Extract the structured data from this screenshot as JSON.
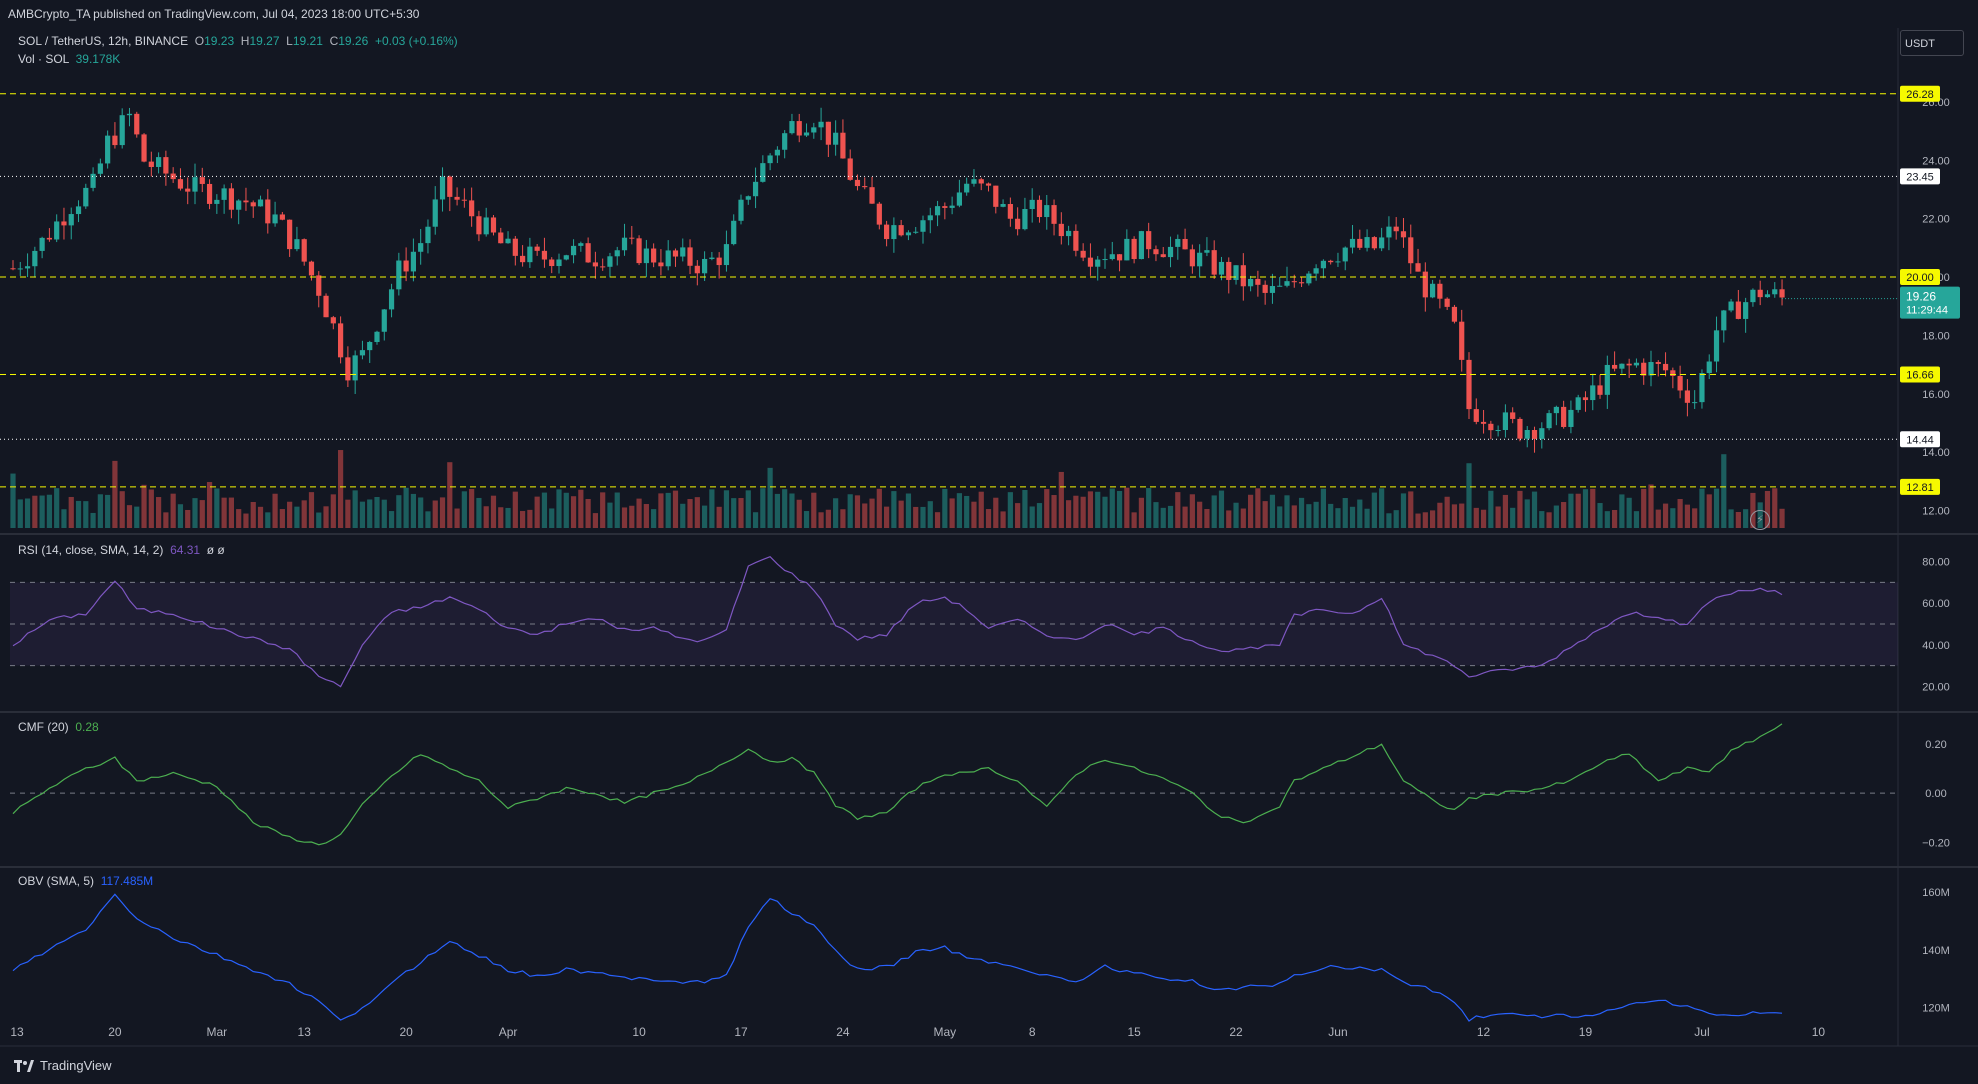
{
  "header": {
    "published_by": "AMBCrypto_TA published on TradingView.com, Jul 04, 2023 18:00 UTC+5:30"
  },
  "currency_box": "USDT",
  "legend": {
    "symbol": "SOL / TetherUS, 12h, BINANCE",
    "o_label": "O",
    "o_value": "19.23",
    "h_label": "H",
    "h_value": "19.27",
    "l_label": "L",
    "l_value": "19.21",
    "c_label": "C",
    "c_value": "19.26",
    "change": "+0.03 (+0.16%)",
    "volume_label": "Vol · SOL",
    "volume_value": "39.178K"
  },
  "indicators": {
    "rsi_label": "RSI (14, close, SMA, 14, 2)",
    "rsi_value": "64.31",
    "rsi_extra": "ø ø",
    "cmf_label": "CMF (20)",
    "cmf_value": "0.28",
    "obv_label": "OBV (SMA, 5)",
    "obv_value": "117.485M"
  },
  "footer": {
    "brand": "TradingView"
  },
  "colors": {
    "bull": "#26a69a",
    "bear": "#ef5350",
    "level": "#f6f900",
    "rsi": "#7e57c2",
    "cmf": "#4caf50",
    "obv": "#2962ff"
  },
  "chart_data": [
    {
      "type": "candlestick",
      "title": "SOL / TetherUS, 12h, BINANCE",
      "ylim": [
        11.4,
        27.3
      ],
      "y_ticks": [
        12,
        14,
        16,
        18,
        20,
        22,
        24,
        26
      ],
      "x_ticks": [
        "13",
        "20",
        "Mar",
        "13",
        "20",
        "Apr",
        "10",
        "17",
        "24",
        "May",
        "8",
        "15",
        "22",
        "Jun",
        "12",
        "19",
        "Jul",
        "10"
      ],
      "last_price": "19.26",
      "countdown": "11:29:44",
      "horizontal_levels": [
        {
          "value": 26.28,
          "label": "26.28",
          "style": "dashed",
          "color": "#f6f900"
        },
        {
          "value": 23.45,
          "label": "23.45",
          "style": "dotted",
          "color": "#ffffff"
        },
        {
          "value": 20.0,
          "label": "20.00",
          "style": "dashed",
          "color": "#f6f900"
        },
        {
          "value": 16.66,
          "label": "16.66",
          "style": "dashed",
          "color": "#f6f900"
        },
        {
          "value": 14.44,
          "label": "14.44",
          "style": "dotted",
          "color": "#ffffff"
        },
        {
          "value": 12.81,
          "label": "12.81",
          "style": "dashed",
          "color": "#f6f900"
        }
      ],
      "close_path": [
        [
          0,
          20.3
        ],
        [
          4,
          21.2
        ],
        [
          8,
          22.5
        ],
        [
          11,
          23.1
        ],
        [
          13,
          24.6
        ],
        [
          16,
          25.5
        ],
        [
          18,
          24.0
        ],
        [
          22,
          23.4
        ],
        [
          25,
          23.0
        ],
        [
          28,
          22.9
        ],
        [
          32,
          22.6
        ],
        [
          36,
          22.0
        ],
        [
          39,
          21.0
        ],
        [
          42,
          19.6
        ],
        [
          44,
          18.3
        ],
        [
          46,
          16.9
        ],
        [
          48,
          17.3
        ],
        [
          50,
          18.5
        ],
        [
          53,
          20.2
        ],
        [
          56,
          21.2
        ],
        [
          59,
          23.0
        ],
        [
          62,
          22.4
        ],
        [
          65,
          21.6
        ],
        [
          68,
          20.9
        ],
        [
          72,
          20.6
        ],
        [
          76,
          20.9
        ],
        [
          80,
          20.7
        ],
        [
          84,
          21.0
        ],
        [
          88,
          20.7
        ],
        [
          92,
          20.6
        ],
        [
          95,
          20.4
        ],
        [
          98,
          20.9
        ],
        [
          101,
          23.0
        ],
        [
          104,
          24.2
        ],
        [
          107,
          25.2
        ],
        [
          110,
          25.5
        ],
        [
          113,
          24.5
        ],
        [
          116,
          23.0
        ],
        [
          120,
          21.7
        ],
        [
          124,
          21.9
        ],
        [
          128,
          22.4
        ],
        [
          131,
          23.2
        ],
        [
          134,
          22.9
        ],
        [
          137,
          22.0
        ],
        [
          141,
          22.3
        ],
        [
          145,
          21.5
        ],
        [
          148,
          20.8
        ],
        [
          152,
          20.9
        ],
        [
          156,
          21.2
        ],
        [
          160,
          20.9
        ],
        [
          164,
          20.5
        ],
        [
          168,
          20.0
        ],
        [
          172,
          19.4
        ],
        [
          175,
          19.6
        ],
        [
          179,
          20.6
        ],
        [
          183,
          21.0
        ],
        [
          187,
          21.0
        ],
        [
          190,
          21.7
        ],
        [
          193,
          20.0
        ],
        [
          196,
          19.0
        ],
        [
          198,
          18.2
        ],
        [
          200,
          15.5
        ],
        [
          203,
          15.2
        ],
        [
          207,
          14.8
        ],
        [
          211,
          15.0
        ],
        [
          215,
          15.5
        ],
        [
          219,
          16.6
        ],
        [
          223,
          17.0
        ],
        [
          227,
          16.8
        ],
        [
          231,
          15.8
        ],
        [
          234,
          18.2
        ],
        [
          237,
          19.0
        ],
        [
          240,
          19.5
        ],
        [
          243,
          19.26
        ]
      ]
    },
    {
      "type": "line",
      "name": "RSI (14, close, SMA, 14, 2)",
      "ylim": [
        12,
        88
      ],
      "y_ticks": [
        20,
        40,
        60,
        80
      ],
      "bands": [
        30,
        50,
        70
      ],
      "points": [
        [
          0,
          40
        ],
        [
          5,
          52
        ],
        [
          10,
          55
        ],
        [
          14,
          71
        ],
        [
          17,
          57
        ],
        [
          22,
          55
        ],
        [
          28,
          48
        ],
        [
          33,
          43
        ],
        [
          38,
          38
        ],
        [
          42,
          25
        ],
        [
          45,
          20
        ],
        [
          48,
          40
        ],
        [
          52,
          56
        ],
        [
          56,
          58
        ],
        [
          60,
          63
        ],
        [
          64,
          57
        ],
        [
          68,
          48
        ],
        [
          72,
          45
        ],
        [
          76,
          50
        ],
        [
          80,
          53
        ],
        [
          84,
          47
        ],
        [
          88,
          48
        ],
        [
          92,
          43
        ],
        [
          95,
          42
        ],
        [
          98,
          47
        ],
        [
          101,
          78
        ],
        [
          104,
          82
        ],
        [
          107,
          74
        ],
        [
          110,
          67
        ],
        [
          113,
          50
        ],
        [
          116,
          43
        ],
        [
          120,
          45
        ],
        [
          124,
          60
        ],
        [
          128,
          63
        ],
        [
          131,
          57
        ],
        [
          134,
          48
        ],
        [
          138,
          52
        ],
        [
          142,
          45
        ],
        [
          146,
          42
        ],
        [
          150,
          50
        ],
        [
          154,
          45
        ],
        [
          158,
          48
        ],
        [
          162,
          42
        ],
        [
          166,
          37
        ],
        [
          170,
          38
        ],
        [
          174,
          40
        ],
        [
          176,
          54
        ],
        [
          180,
          57
        ],
        [
          184,
          55
        ],
        [
          188,
          63
        ],
        [
          191,
          40
        ],
        [
          195,
          35
        ],
        [
          198,
          30
        ],
        [
          200,
          25
        ],
        [
          205,
          28
        ],
        [
          210,
          30
        ],
        [
          214,
          39
        ],
        [
          218,
          48
        ],
        [
          222,
          55
        ],
        [
          226,
          54
        ],
        [
          230,
          49
        ],
        [
          233,
          61
        ],
        [
          236,
          65
        ],
        [
          240,
          67
        ],
        [
          243,
          64.31
        ]
      ]
    },
    {
      "type": "line",
      "name": "CMF (20)",
      "ylim": [
        -0.28,
        0.31
      ],
      "y_ticks": [
        -0.2,
        0.0,
        0.2
      ],
      "bands": [
        0
      ],
      "points": [
        [
          0,
          -0.08
        ],
        [
          5,
          0.02
        ],
        [
          10,
          0.1
        ],
        [
          14,
          0.14
        ],
        [
          17,
          0.05
        ],
        [
          22,
          0.08
        ],
        [
          28,
          0.03
        ],
        [
          33,
          -0.12
        ],
        [
          38,
          -0.18
        ],
        [
          42,
          -0.21
        ],
        [
          45,
          -0.17
        ],
        [
          48,
          -0.05
        ],
        [
          52,
          0.07
        ],
        [
          56,
          0.16
        ],
        [
          60,
          0.1
        ],
        [
          64,
          0.05
        ],
        [
          68,
          -0.06
        ],
        [
          72,
          -0.02
        ],
        [
          76,
          0.02
        ],
        [
          80,
          0.0
        ],
        [
          84,
          -0.04
        ],
        [
          88,
          0.0
        ],
        [
          92,
          0.03
        ],
        [
          95,
          0.08
        ],
        [
          98,
          0.13
        ],
        [
          101,
          0.18
        ],
        [
          104,
          0.13
        ],
        [
          107,
          0.14
        ],
        [
          110,
          0.08
        ],
        [
          113,
          -0.05
        ],
        [
          116,
          -0.1
        ],
        [
          120,
          -0.08
        ],
        [
          124,
          0.02
        ],
        [
          128,
          0.08
        ],
        [
          131,
          0.08
        ],
        [
          134,
          0.1
        ],
        [
          138,
          0.05
        ],
        [
          142,
          -0.06
        ],
        [
          146,
          0.08
        ],
        [
          150,
          0.14
        ],
        [
          154,
          0.1
        ],
        [
          158,
          0.06
        ],
        [
          162,
          0.0
        ],
        [
          166,
          -0.1
        ],
        [
          170,
          -0.12
        ],
        [
          174,
          -0.05
        ],
        [
          176,
          0.05
        ],
        [
          180,
          0.1
        ],
        [
          184,
          0.15
        ],
        [
          188,
          0.2
        ],
        [
          191,
          0.05
        ],
        [
          195,
          -0.03
        ],
        [
          198,
          -0.07
        ],
        [
          200,
          -0.02
        ],
        [
          205,
          0.0
        ],
        [
          210,
          0.02
        ],
        [
          214,
          0.05
        ],
        [
          218,
          0.12
        ],
        [
          222,
          0.16
        ],
        [
          226,
          0.05
        ],
        [
          230,
          0.1
        ],
        [
          233,
          0.09
        ],
        [
          236,
          0.17
        ],
        [
          240,
          0.23
        ],
        [
          243,
          0.28
        ]
      ]
    },
    {
      "type": "line",
      "name": "OBV (SMA, 5)",
      "ylim": [
        108,
        167
      ],
      "y_ticks": [
        "120M",
        "140M",
        "160M"
      ],
      "y_tick_values": [
        120,
        140,
        160
      ],
      "points": [
        [
          0,
          133
        ],
        [
          5,
          140
        ],
        [
          10,
          147
        ],
        [
          14,
          159
        ],
        [
          17,
          151
        ],
        [
          22,
          144
        ],
        [
          28,
          138
        ],
        [
          33,
          133
        ],
        [
          38,
          128
        ],
        [
          42,
          122
        ],
        [
          45,
          115
        ],
        [
          48,
          120
        ],
        [
          52,
          128
        ],
        [
          56,
          136
        ],
        [
          60,
          143
        ],
        [
          64,
          138
        ],
        [
          68,
          133
        ],
        [
          72,
          131
        ],
        [
          76,
          133
        ],
        [
          80,
          132
        ],
        [
          84,
          130
        ],
        [
          88,
          130
        ],
        [
          92,
          129
        ],
        [
          95,
          129
        ],
        [
          98,
          131
        ],
        [
          101,
          148
        ],
        [
          104,
          158
        ],
        [
          107,
          153
        ],
        [
          110,
          148
        ],
        [
          113,
          140
        ],
        [
          116,
          133
        ],
        [
          120,
          134
        ],
        [
          124,
          139
        ],
        [
          128,
          141
        ],
        [
          131,
          137
        ],
        [
          134,
          136
        ],
        [
          138,
          134
        ],
        [
          142,
          131
        ],
        [
          146,
          129
        ],
        [
          150,
          134
        ],
        [
          154,
          132
        ],
        [
          158,
          130
        ],
        [
          162,
          129
        ],
        [
          166,
          126
        ],
        [
          170,
          127
        ],
        [
          174,
          128
        ],
        [
          176,
          131
        ],
        [
          180,
          134
        ],
        [
          184,
          134
        ],
        [
          188,
          133
        ],
        [
          191,
          129
        ],
        [
          195,
          126
        ],
        [
          198,
          122
        ],
        [
          200,
          116
        ],
        [
          205,
          118
        ],
        [
          210,
          117
        ],
        [
          214,
          117
        ],
        [
          218,
          118
        ],
        [
          222,
          121
        ],
        [
          226,
          123
        ],
        [
          230,
          120
        ],
        [
          233,
          118
        ],
        [
          236,
          117
        ],
        [
          240,
          118
        ],
        [
          243,
          117.485
        ]
      ]
    }
  ]
}
